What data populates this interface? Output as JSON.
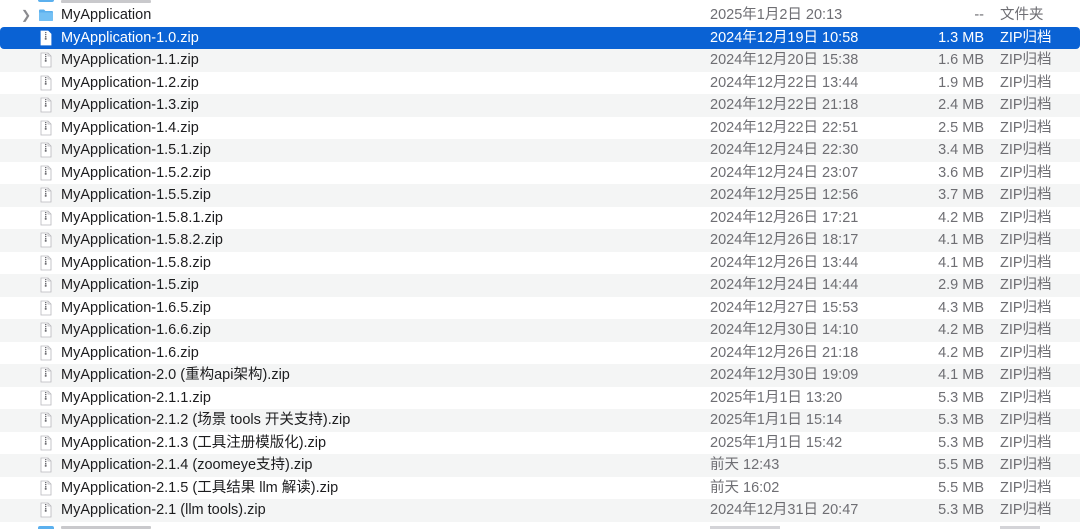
{
  "folder": {
    "name": "MyApplication",
    "date": "2025年1月2日 20:13",
    "size": "--",
    "kind": "文件夹",
    "disclosure_icon": "chevron-right-icon",
    "icon": "folder-icon"
  },
  "colors": {
    "selection": "#0a62d4",
    "alt_row": "#f4f5f5",
    "folder_blue": "#5bb0ee"
  },
  "files": [
    {
      "name": "MyApplication-1.0.zip",
      "date": "2024年12月19日 10:58",
      "size": "1.3 MB",
      "kind": "ZIP归档",
      "selected": true
    },
    {
      "name": "MyApplication-1.1.zip",
      "date": "2024年12月20日 15:38",
      "size": "1.6 MB",
      "kind": "ZIP归档"
    },
    {
      "name": "MyApplication-1.2.zip",
      "date": "2024年12月22日 13:44",
      "size": "1.9 MB",
      "kind": "ZIP归档"
    },
    {
      "name": "MyApplication-1.3.zip",
      "date": "2024年12月22日 21:18",
      "size": "2.4 MB",
      "kind": "ZIP归档"
    },
    {
      "name": "MyApplication-1.4.zip",
      "date": "2024年12月22日 22:51",
      "size": "2.5 MB",
      "kind": "ZIP归档"
    },
    {
      "name": "MyApplication-1.5.1.zip",
      "date": "2024年12月24日 22:30",
      "size": "3.4 MB",
      "kind": "ZIP归档"
    },
    {
      "name": "MyApplication-1.5.2.zip",
      "date": "2024年12月24日 23:07",
      "size": "3.6 MB",
      "kind": "ZIP归档"
    },
    {
      "name": "MyApplication-1.5.5.zip",
      "date": "2024年12月25日 12:56",
      "size": "3.7 MB",
      "kind": "ZIP归档"
    },
    {
      "name": "MyApplication-1.5.8.1.zip",
      "date": "2024年12月26日 17:21",
      "size": "4.2 MB",
      "kind": "ZIP归档"
    },
    {
      "name": "MyApplication-1.5.8.2.zip",
      "date": "2024年12月26日 18:17",
      "size": "4.1 MB",
      "kind": "ZIP归档"
    },
    {
      "name": "MyApplication-1.5.8.zip",
      "date": "2024年12月26日 13:44",
      "size": "4.1 MB",
      "kind": "ZIP归档"
    },
    {
      "name": "MyApplication-1.5.zip",
      "date": "2024年12月24日 14:44",
      "size": "2.9 MB",
      "kind": "ZIP归档"
    },
    {
      "name": "MyApplication-1.6.5.zip",
      "date": "2024年12月27日 15:53",
      "size": "4.3 MB",
      "kind": "ZIP归档"
    },
    {
      "name": "MyApplication-1.6.6.zip",
      "date": "2024年12月30日 14:10",
      "size": "4.2 MB",
      "kind": "ZIP归档"
    },
    {
      "name": "MyApplication-1.6.zip",
      "date": "2024年12月26日 21:18",
      "size": "4.2 MB",
      "kind": "ZIP归档"
    },
    {
      "name": "MyApplication-2.0 (重构api架构).zip",
      "date": "2024年12月30日 19:09",
      "size": "4.1 MB",
      "kind": "ZIP归档"
    },
    {
      "name": "MyApplication-2.1.1.zip",
      "date": "2025年1月1日 13:20",
      "size": "5.3 MB",
      "kind": "ZIP归档"
    },
    {
      "name": "MyApplication-2.1.2 (场景 tools 开关支持).zip",
      "date": "2025年1月1日 15:14",
      "size": "5.3 MB",
      "kind": "ZIP归档"
    },
    {
      "name": "MyApplication-2.1.3 (工具注册模版化).zip",
      "date": "2025年1月1日 15:42",
      "size": "5.3 MB",
      "kind": "ZIP归档"
    },
    {
      "name": "MyApplication-2.1.4 (zoomeye支持).zip",
      "date": "前天 12:43",
      "size": "5.5 MB",
      "kind": "ZIP归档"
    },
    {
      "name": "MyApplication-2.1.5 (工具结果 llm 解读).zip",
      "date": "前天 16:02",
      "size": "5.5 MB",
      "kind": "ZIP归档"
    },
    {
      "name": "MyApplication-2.1 (llm tools).zip",
      "date": "2024年12月31日 20:47",
      "size": "5.3 MB",
      "kind": "ZIP归档"
    }
  ],
  "file_icon": "zip-file-icon"
}
